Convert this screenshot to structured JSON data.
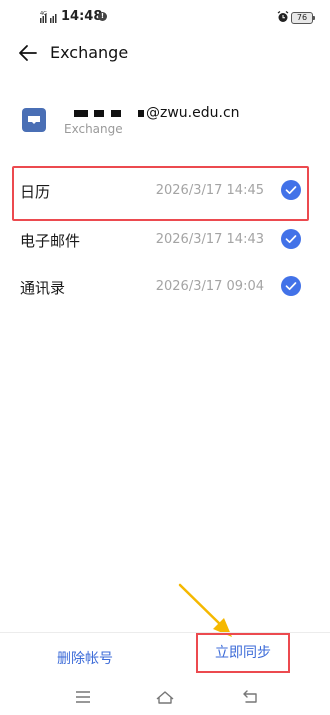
{
  "status_bar": {
    "network": "4G",
    "time": "14:48",
    "battery": "76"
  },
  "header": {
    "title": "Exchange"
  },
  "account": {
    "email_domain": "@zwu.edu.cn",
    "type": "Exchange"
  },
  "sync_items": [
    {
      "label": "日历",
      "timestamp": "2026/3/17 14:45",
      "checked": true
    },
    {
      "label": "电子邮件",
      "timestamp": "2026/3/17 14:43",
      "checked": true
    },
    {
      "label": "通讯录",
      "timestamp": "2026/3/17 09:04",
      "checked": true
    }
  ],
  "actions": {
    "delete_label": "删除帐号",
    "sync_label": "立即同步"
  },
  "colors": {
    "accent": "#3c6bd8",
    "check": "#4272e8",
    "highlight": "#ec4a4f",
    "arrow": "#f5b800"
  },
  "icons": [
    "signal-icon",
    "info-icon",
    "alarm-icon",
    "battery-icon",
    "back-arrow-icon",
    "exchange-mail-icon",
    "checkmark-icon",
    "menu-icon",
    "home-icon",
    "back-nav-icon"
  ]
}
